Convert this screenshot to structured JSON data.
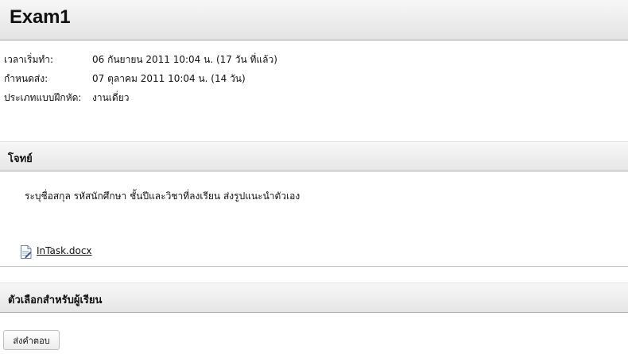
{
  "assignment": {
    "title": "Exam1"
  },
  "meta": {
    "start": {
      "label": "เวลาเริ่มทำ:",
      "value": "06 กันยายน 2011 10:04 น. (17 วัน ที่แล้ว)"
    },
    "due": {
      "label": "กำหนดส่ง:",
      "value": "07 ตุลาคม 2011 10:04 น. (14 วัน)"
    },
    "type": {
      "label": "ประเภทแบบฝึกหัด:",
      "value": "งานเดี่ยว"
    }
  },
  "question_section": {
    "heading": "โจทย์",
    "instructions": "ระบุชื่อสกุล รหัสนักศึกษา ชั้นปีและวิชาที่ลงเรียน  ส่งรูปแนะนำตัวเอง",
    "attachment": {
      "filename": "InTask.docx",
      "icon": "document-icon"
    }
  },
  "student_section": {
    "heading": "ตัวเลือกสำหรับผู้เรียน",
    "submit_label": "ส่งคำตอบ"
  }
}
